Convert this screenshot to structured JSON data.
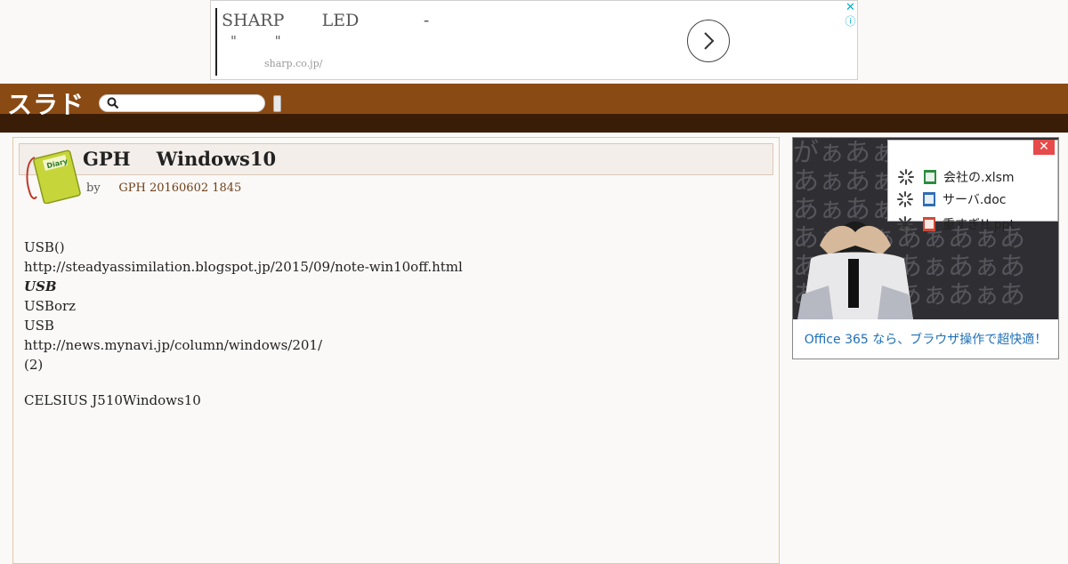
{
  "top_ad": {
    "headline": "SHARP       LED            -",
    "subline": "\"         \"",
    "domain": "sharp.co.jp/",
    "close": "✕",
    "info": "ⓘ"
  },
  "header": {
    "logo": "スラド",
    "search_placeholder": ""
  },
  "article": {
    "title": "GPH    Windows10",
    "byline_prefix": "by",
    "byline_author": "GPH 20160602 1845",
    "body": [
      "USB()",
      "http://steadyassimilation.blogspot.jp/2015/09/note-win10off.html",
      "",
      "",
      "USB",
      "",
      "USBorz",
      "USB",
      "",
      "http://news.mynavi.jp/column/windows/201/",
      "",
      "(2)",
      "",
      "CELSIUS J510Windows10"
    ]
  },
  "side_ad": {
    "bg_glyphs": "がぁあぁあぁあぁあ\nあぁあぁあぁあぁあ\nあぁあぁあぁあぁあ\nあぁあぁあぁあぁあ\nあぁあぁあぁあぁあ\nあぁあぁあぁあぁあ",
    "files": [
      {
        "name": "会社の.xlsm",
        "color": "#2e8b3e"
      },
      {
        "name": "サーバ.doc",
        "color": "#2f6db5"
      },
      {
        "name": "重すぎ!!.ppt",
        "color": "#d04a3a"
      }
    ],
    "close": "✕",
    "tagline": "Office 365 なら、ブラウザ操作で超快適！"
  }
}
